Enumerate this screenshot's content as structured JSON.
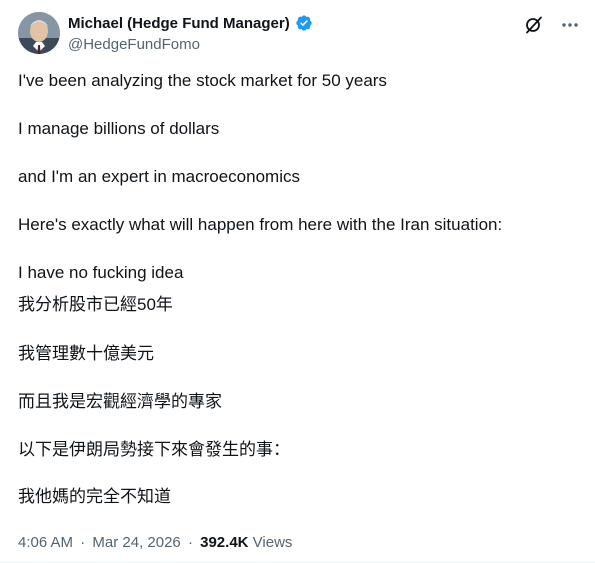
{
  "author": {
    "display_name": "Michael (Hedge Fund Manager)",
    "handle": "@HedgeFundFomo",
    "verified": true,
    "verified_color": "#1d9bf0"
  },
  "actions": {
    "grok_icon": "grok-icon",
    "more_icon": "more-options-icon"
  },
  "tweet": {
    "lines": [
      "I've been analyzing the stock market for 50 years",
      "I manage billions of dollars",
      "and I'm an expert in macroeconomics",
      "Here's exactly what will happen from here with the Iran situation:",
      "I have no fucking idea",
      "我分析股市已經50年",
      "我管理數十億美元",
      "而且我是宏觀經濟學的專家",
      "以下是伊朗局勢接下來會發生的事：",
      "我他媽的完全不知道"
    ]
  },
  "meta": {
    "time": "4:06 AM",
    "separator": "·",
    "date": "Mar 24, 2026",
    "views_count": "392.4K",
    "views_label": "Views"
  }
}
